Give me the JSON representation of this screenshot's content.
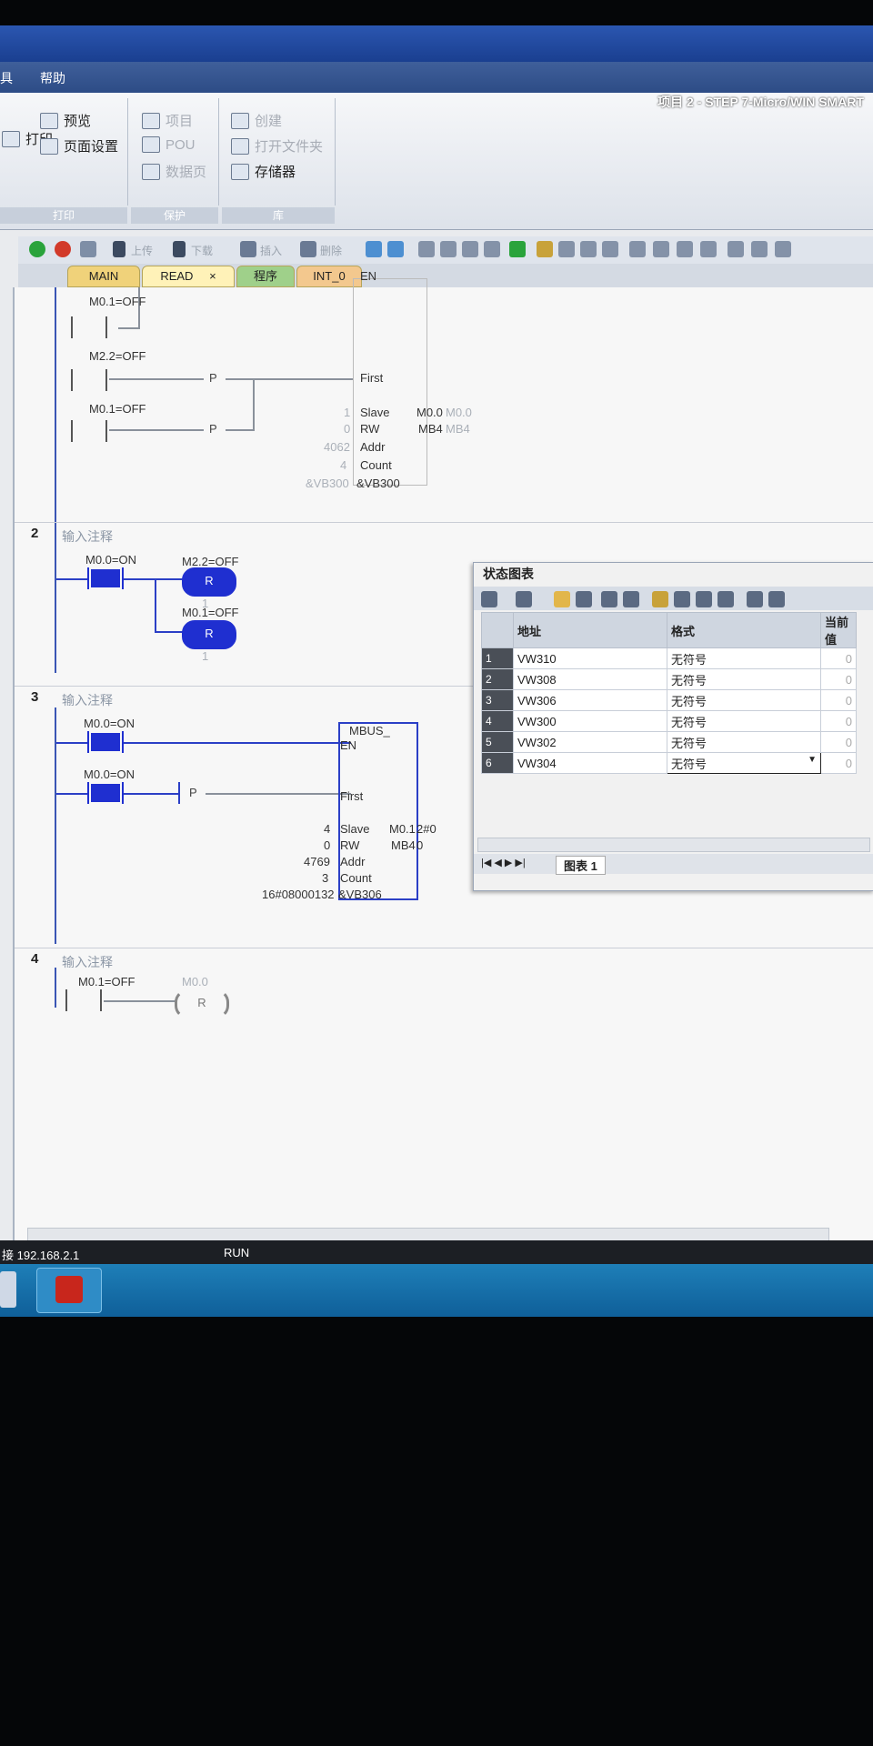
{
  "menu": {
    "left_fragment": "具",
    "help": "帮助"
  },
  "window": {
    "title": "项目 2 - STEP 7-Micro/WIN SMART"
  },
  "ribbon": {
    "print_group": {
      "print": "打印",
      "preview": "预览",
      "page_setup": "页面设置",
      "label": "打印"
    },
    "protect_group": {
      "project": "项目",
      "pou": "POU",
      "data_page": "数据页",
      "label": "保护"
    },
    "library_group": {
      "create": "创建",
      "open_folder": "打开文件夹",
      "memory": "存储器",
      "label": "库"
    }
  },
  "toolbar": {
    "upload": "上传",
    "download": "下载",
    "insert": "插入",
    "delete": "删除"
  },
  "tabs": [
    "MAIN",
    "READ",
    "程序",
    "INT_0"
  ],
  "tab_close": "×",
  "network1": {
    "contacts": [
      "M0.1=OFF",
      "M2.2=OFF",
      "M0.1=OFF"
    ],
    "p_label": "P",
    "block_pins": [
      "EN",
      "First",
      "Slave",
      "RW",
      "Addr",
      "Count",
      "&VB300"
    ],
    "pin_values": {
      "slave": "1",
      "rw": "0",
      "addr": "4062",
      "count": "4",
      "dataptr": "&VB300"
    },
    "outputs": [
      {
        "label": "M0.0",
        "value": "M0.0"
      },
      {
        "label": "MB4",
        "value": "MB4"
      }
    ]
  },
  "network2": {
    "number": "2",
    "comment": "输入注释",
    "contact": "M0.0=ON",
    "coils": [
      {
        "addr": "M2.2=OFF",
        "op": "R",
        "n": "1"
      },
      {
        "addr": "M0.1=OFF",
        "op": "R",
        "n": "1"
      }
    ]
  },
  "network3": {
    "number": "3",
    "comment": "输入注释",
    "contacts": [
      "M0.0=ON",
      "M0.0=ON"
    ],
    "p_label": "P",
    "block_name": "MBUS_",
    "pins": [
      "EN",
      "First",
      "Slave",
      "RW",
      "Addr",
      "Count",
      "&VB306"
    ],
    "pin_values": {
      "slave": "4",
      "rw": "0",
      "addr": "4769",
      "count": "3",
      "dataptr": "16#08000132"
    },
    "outputs": [
      {
        "label": "M0.1",
        "value": "2#0"
      },
      {
        "label": "MB4",
        "value": "0"
      }
    ]
  },
  "network4": {
    "number": "4",
    "comment": "输入注释",
    "contact": "M0.1=OFF",
    "coil_addr": "M0.0",
    "coil_op": "R"
  },
  "status_chart": {
    "title": "状态图表",
    "headers": [
      "地址",
      "格式",
      "当前值"
    ],
    "rows": [
      {
        "n": "1",
        "addr": "VW310",
        "fmt": "无符号",
        "val": "0"
      },
      {
        "n": "2",
        "addr": "VW308",
        "fmt": "无符号",
        "val": "0"
      },
      {
        "n": "3",
        "addr": "VW306",
        "fmt": "无符号",
        "val": "0"
      },
      {
        "n": "4",
        "addr": "VW300",
        "fmt": "无符号",
        "val": "0"
      },
      {
        "n": "5",
        "addr": "VW302",
        "fmt": "无符号",
        "val": "0"
      },
      {
        "n": "6",
        "addr": "VW304",
        "fmt": "无符号",
        "val": "0"
      }
    ],
    "sheet_tab": "图表 1"
  },
  "status": {
    "connection": "接 192.168.2.1",
    "mode": "RUN"
  },
  "colors": {
    "active": "#1f2fd0",
    "titlebar": "#2b56b0",
    "taskbar": "#1e7fb8"
  }
}
